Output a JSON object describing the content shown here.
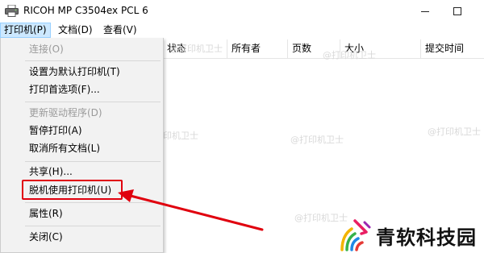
{
  "window": {
    "title": "RICOH MP C3504ex PCL 6",
    "min_icon": "minimize-icon",
    "max_icon": "maximize-icon"
  },
  "menubar": {
    "printer": "打印机(P)",
    "document": "文档(D)",
    "view": "查看(V)"
  },
  "columns": {
    "status": "状态",
    "owner": "所有者",
    "pages": "页数",
    "size": "大小",
    "submit_time": "提交时间"
  },
  "dropdown": {
    "connect": "连接(O)",
    "set_default": "设置为默认打印机(T)",
    "preferences": "打印首选项(F)...",
    "update_driver": "更新驱动程序(D)",
    "pause": "暂停打印(A)",
    "cancel_all": "取消所有文档(L)",
    "share": "共享(H)...",
    "use_offline": "脱机使用打印机(U)",
    "properties": "属性(R)",
    "close": "关闭(C)"
  },
  "watermark": "@打印机卫士",
  "brand": {
    "name": "青软科技园",
    "accent_color": "#e0000e"
  }
}
